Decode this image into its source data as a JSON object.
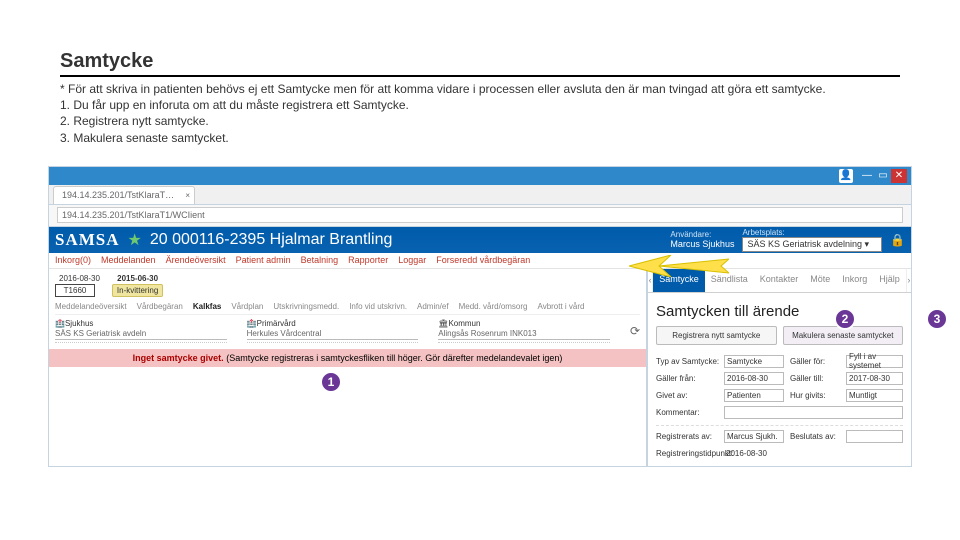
{
  "slide": {
    "title": "Samtycke",
    "bullets": [
      "* För att skriva in patienten behövs ej ett Samtycke men för att komma vidare i processen eller avsluta den är man tvingad att göra ett samtycke.",
      "1. Du får upp en inforuta om att du måste registrera ett Samtycke.",
      "2. Registrera nytt samtycke.",
      "3. Makulera senaste samtycket."
    ]
  },
  "browser": {
    "tab": "194.14.235.201/TstKlaraT…",
    "url": "194.14.235.201/TstKlaraT1/WCIient"
  },
  "header": {
    "logo": "SAMSA",
    "patient_id": "20 000116-2395 Hjalmar Brantling",
    "user_label": "Användare:",
    "user_value": "Marcus Sjukhus",
    "workplace_label": "Arbetsplats:",
    "workplace_value": "SÄS KS Geriatrisk avdelning"
  },
  "menu": [
    "Inkorg(0)",
    "Meddelanden",
    "Ärendeöversikt",
    "Patient admin",
    "Betalning",
    "Rapporter",
    "Loggar",
    "Forseredd vårdbegäran"
  ],
  "dates": {
    "d1": "2016-08-30",
    "d2": "2015-06-30",
    "code": "T1660",
    "status": "In-kvittering"
  },
  "subnav": [
    "Meddelandeöversikt",
    "Vårdbegäran",
    "Kalkfas",
    "Vårdplan",
    "Utskrivningsmedd.",
    "Info vid utskrivn.",
    "Admin/ef",
    "Medd. vård/omsorg",
    "Avbrott i vård"
  ],
  "providers": {
    "col1": {
      "lbl": "Sjukhus",
      "val": "SÄS KS Geriatrisk avdeln"
    },
    "col2": {
      "lbl": "Primärvård",
      "val": "Herkules Vårdcentral"
    },
    "col3": {
      "lbl": "Kommun",
      "val": "Alingsås Rosenrum INK013"
    }
  },
  "pink": {
    "bold": "Inget samtycke givet.",
    "rest": "(Samtycke registreras i samtyckesfliken till höger. Gör därefter medelandevalet igen)"
  },
  "side": {
    "tabs": [
      "Samtycke",
      "Sändlista",
      "Kontakter",
      "Möte",
      "Inkorg",
      "Hjälp"
    ],
    "title": "Samtycken till ärende",
    "btn_reg": "Registrera nytt samtycke",
    "btn_mak": "Makulera senaste samtycket",
    "form": {
      "typ_lbl": "Typ av Samtycke:",
      "typ_val": "Samtycke",
      "galler_lbl": "Gäller för:",
      "galler_val": "Fyll i av systemet",
      "fran_lbl": "Gäller från:",
      "fran_val": "2016-08-30",
      "till_lbl": "Gäller till:",
      "till_val": "2017-08-30",
      "givet_lbl": "Givet av:",
      "givet_val": "Patienten",
      "grund_lbl": "Hur givits:",
      "grund_val": "Muntligt",
      "komm_lbl": "Kommentar:",
      "reg_lbl": "Registrerats av:",
      "reg_val": "Marcus Sjukh.",
      "besl_lbl": "Beslutats av:",
      "besl_val": "",
      "tid_lbl": "Registreringstidpunkt:",
      "tid_val": "2016-08-30"
    }
  },
  "annot": {
    "n1": "1",
    "n2": "2",
    "n3": "3"
  }
}
